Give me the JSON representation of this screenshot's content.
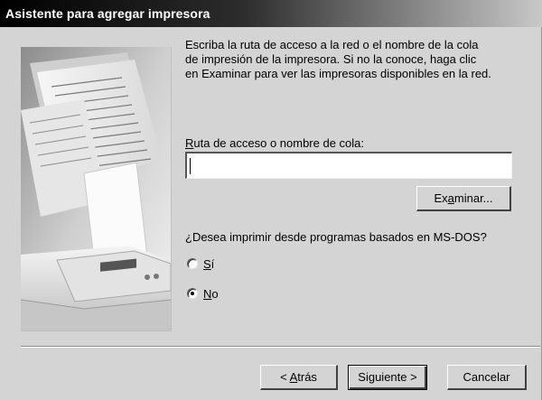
{
  "window": {
    "title": "Asistente para agregar impresora"
  },
  "instructions": {
    "line1": "Escriba la ruta de acceso a la red o el nombre de la cola",
    "line2": "de impresión de la impresora. Si no la conoce, haga clic",
    "line3": "en Examinar para ver las impresoras disponibles en la red."
  },
  "path_field": {
    "label_mnemonic": "R",
    "label_rest": "uta de acceso o nombre de cola:",
    "value": ""
  },
  "browse_button": {
    "label_pre": "Ex",
    "label_mnemonic": "a",
    "label_post": "minar..."
  },
  "msdos": {
    "question": "¿Desea imprimir desde programas basados en MS-DOS?",
    "options": [
      {
        "mnemonic": "S",
        "rest": "í",
        "checked": false
      },
      {
        "mnemonic": "N",
        "rest": "o",
        "checked": true
      }
    ]
  },
  "footer": {
    "back_pre": "< ",
    "back_mnemonic": "A",
    "back_post": "trás",
    "next_label": "Siguiente >",
    "cancel_label": "Cancelar"
  },
  "illustration": {
    "icon": "printer-document-illustration"
  }
}
